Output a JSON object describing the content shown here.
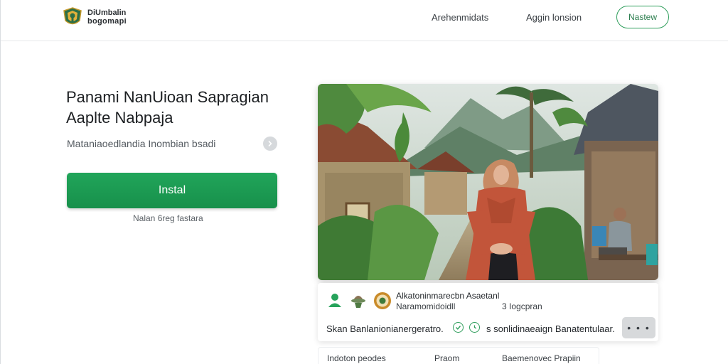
{
  "header": {
    "brand_line1": "DiUmbalin",
    "brand_line2": "bogomapi",
    "nav": [
      "Arehenmidats",
      "Aggin lonsion"
    ],
    "cta_label": "Nastew"
  },
  "hero": {
    "title": "Panami NanUioan Sapragian Aaplte Nabpaja",
    "subtitle": "Mataniaoedlandia Inombian bsadi",
    "install_label": "Instal",
    "install_note": "Nalan 6reg fastara"
  },
  "card": {
    "title": "Alkatoninmarecbn Asaetanl",
    "subtitle": "Naramomidoidll",
    "meta": "3 Iogcpran",
    "left_text": "Skan Banlanionianergeratro.",
    "right_text": "s sonlidinaeaign Banatentulaar.",
    "more_label": "• • •"
  },
  "bottom": {
    "items": [
      "Indoton peodes",
      "Praom",
      "Baemenovec Prapiin"
    ]
  },
  "colors": {
    "accent": "#1f9b52",
    "accent_outline": "#2f9e5c"
  },
  "icons": [
    "logo-emblem-icon",
    "chevron-right-icon",
    "user-icon",
    "hat-icon",
    "badge-icon",
    "check-circle-icon",
    "clock-circle-icon"
  ]
}
